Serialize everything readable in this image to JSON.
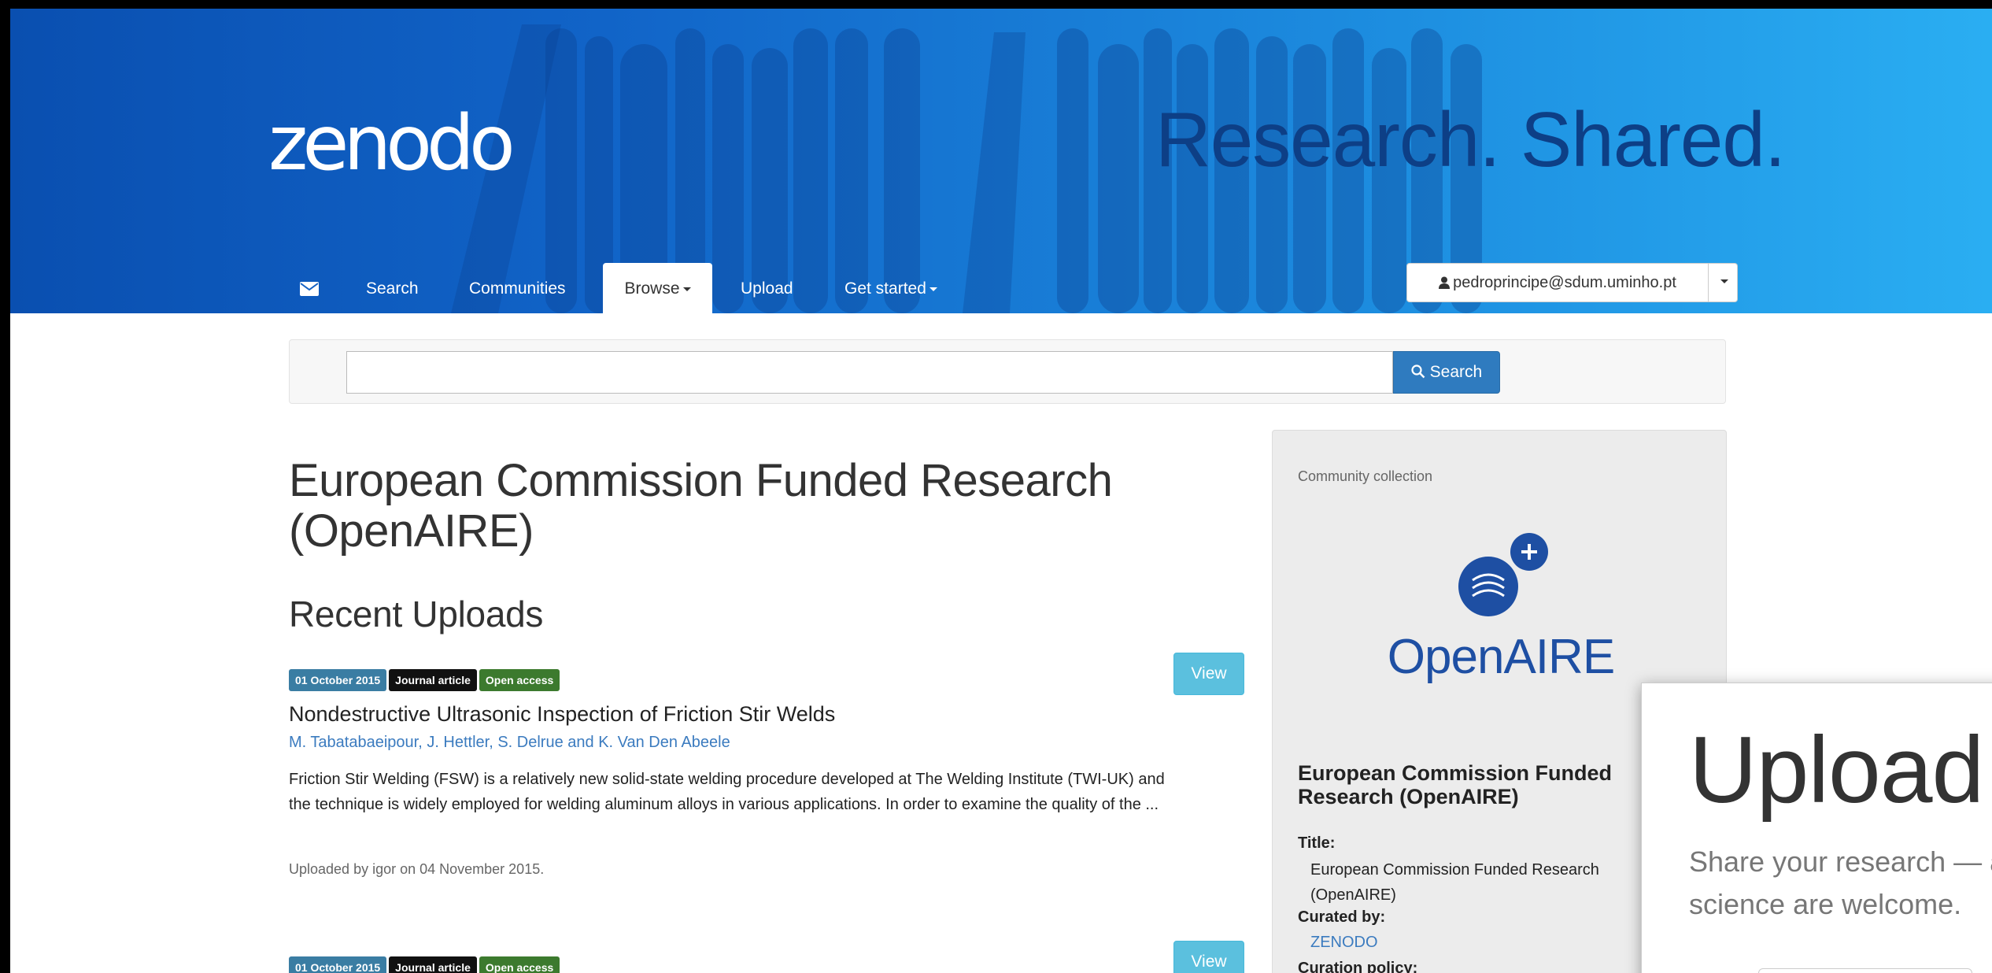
{
  "header": {
    "logo": "zenodo",
    "tagline": "Research. Shared."
  },
  "nav": {
    "mail_icon": "envelope-icon",
    "items": [
      {
        "label": "Search"
      },
      {
        "label": "Communities"
      },
      {
        "label": "Browse",
        "active": true,
        "dropdown": true
      },
      {
        "label": "Upload"
      },
      {
        "label": "Get started",
        "dropdown": true
      }
    ],
    "user": "pedroprincipe@sdum.uminho.pt",
    "user_icon": "user-icon"
  },
  "search": {
    "placeholder": "",
    "button": "Search",
    "button_icon": "search-icon"
  },
  "page": {
    "title": "European Commission Funded Research (OpenAIRE)",
    "recent_heading": "Recent Uploads"
  },
  "records": [
    {
      "date": "01 October 2015",
      "type": "Journal article",
      "access": "Open access",
      "view": "View",
      "title": "Nondestructive Ultrasonic Inspection of Friction Stir Welds",
      "authors": "M. Tabatabaeipour, J. Hettler, S. Delrue and K. Van Den Abeele",
      "description": "Friction Stir Welding (FSW) is a relatively new solid-state welding procedure developed at The Welding Institute (TWI-UK) and the technique is widely employed for welding aluminum alloys in various applications. In order to examine the quality of the ...",
      "meta": "Uploaded by igor on 04 November 2015."
    },
    {
      "date": "01 October 2015",
      "type": "Journal article",
      "access": "Open access",
      "view": "View"
    }
  ],
  "panel": {
    "label": "Community collection",
    "logo_text": "OpenAIRE",
    "name": "European Commission Funded Research (OpenAIRE)",
    "title_label": "Title:",
    "title_value": "European Commission Funded Research (OpenAIRE)",
    "curated_label": "Curated by:",
    "curated_value": "ZENODO",
    "policy_label": "Curation policy:"
  },
  "popup": {
    "title": "Upload",
    "text": "Share your research — a\nscience are welcome."
  },
  "colors": {
    "header_start": "#0a4fb0",
    "header_end": "#2aaef2",
    "search_button": "#2f7bbf",
    "view_button": "#5bc0de",
    "badge_date": "#3a7da3",
    "badge_type": "#111111",
    "badge_oa": "#3c7a2e",
    "link": "#3b7bbf"
  }
}
